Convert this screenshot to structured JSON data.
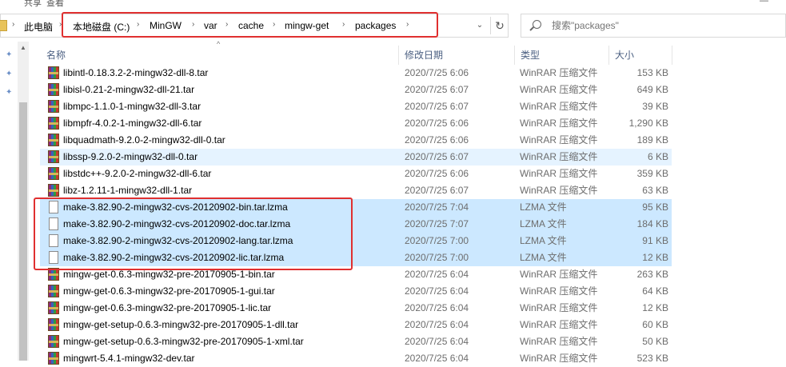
{
  "top_strip": {
    "left1": "共享",
    "left2": "查看",
    "right": "—"
  },
  "breadcrumb": {
    "root": "此电脑",
    "segments": [
      "本地磁盘 (C:)",
      "MinGW",
      "var",
      "cache",
      "mingw-get",
      "packages"
    ]
  },
  "search": {
    "placeholder": "搜索\"packages\""
  },
  "columns": {
    "name": "名称",
    "date": "修改日期",
    "type": "类型",
    "size": "大小"
  },
  "files": [
    {
      "name": "libintl-0.18.3.2-2-mingw32-dll-8.tar",
      "date": "2020/7/25 6:06",
      "type": "WinRAR 压缩文件",
      "size": "153 KB",
      "icon": "rar-archive-icon"
    },
    {
      "name": "libisl-0.21-2-mingw32-dll-21.tar",
      "date": "2020/7/25 6:07",
      "type": "WinRAR 压缩文件",
      "size": "649 KB",
      "icon": "rar-archive-icon"
    },
    {
      "name": "libmpc-1.1.0-1-mingw32-dll-3.tar",
      "date": "2020/7/25 6:07",
      "type": "WinRAR 压缩文件",
      "size": "39 KB",
      "icon": "rar-archive-icon"
    },
    {
      "name": "libmpfr-4.0.2-1-mingw32-dll-6.tar",
      "date": "2020/7/25 6:06",
      "type": "WinRAR 压缩文件",
      "size": "1,290 KB",
      "icon": "rar-archive-icon"
    },
    {
      "name": "libquadmath-9.2.0-2-mingw32-dll-0.tar",
      "date": "2020/7/25 6:06",
      "type": "WinRAR 压缩文件",
      "size": "189 KB",
      "icon": "rar-archive-icon"
    },
    {
      "name": "libssp-9.2.0-2-mingw32-dll-0.tar",
      "date": "2020/7/25 6:07",
      "type": "WinRAR 压缩文件",
      "size": "6 KB",
      "icon": "rar-archive-icon"
    },
    {
      "name": "libstdc++-9.2.0-2-mingw32-dll-6.tar",
      "date": "2020/7/25 6:06",
      "type": "WinRAR 压缩文件",
      "size": "359 KB",
      "icon": "rar-archive-icon"
    },
    {
      "name": "libz-1.2.11-1-mingw32-dll-1.tar",
      "date": "2020/7/25 6:07",
      "type": "WinRAR 压缩文件",
      "size": "63 KB",
      "icon": "rar-archive-icon"
    },
    {
      "name": "make-3.82.90-2-mingw32-cvs-20120902-bin.tar.lzma",
      "date": "2020/7/25 7:04",
      "type": "LZMA 文件",
      "size": "95 KB",
      "icon": "file-icon"
    },
    {
      "name": "make-3.82.90-2-mingw32-cvs-20120902-doc.tar.lzma",
      "date": "2020/7/25 7:07",
      "type": "LZMA 文件",
      "size": "184 KB",
      "icon": "file-icon"
    },
    {
      "name": "make-3.82.90-2-mingw32-cvs-20120902-lang.tar.lzma",
      "date": "2020/7/25 7:00",
      "type": "LZMA 文件",
      "size": "91 KB",
      "icon": "file-icon"
    },
    {
      "name": "make-3.82.90-2-mingw32-cvs-20120902-lic.tar.lzma",
      "date": "2020/7/25 7:00",
      "type": "LZMA 文件",
      "size": "12 KB",
      "icon": "file-icon"
    },
    {
      "name": "mingw-get-0.6.3-mingw32-pre-20170905-1-bin.tar",
      "date": "2020/7/25 6:04",
      "type": "WinRAR 压缩文件",
      "size": "263 KB",
      "icon": "rar-archive-icon"
    },
    {
      "name": "mingw-get-0.6.3-mingw32-pre-20170905-1-gui.tar",
      "date": "2020/7/25 6:04",
      "type": "WinRAR 压缩文件",
      "size": "64 KB",
      "icon": "rar-archive-icon"
    },
    {
      "name": "mingw-get-0.6.3-mingw32-pre-20170905-1-lic.tar",
      "date": "2020/7/25 6:04",
      "type": "WinRAR 压缩文件",
      "size": "12 KB",
      "icon": "rar-archive-icon"
    },
    {
      "name": "mingw-get-setup-0.6.3-mingw32-pre-20170905-1-dll.tar",
      "date": "2020/7/25 6:04",
      "type": "WinRAR 压缩文件",
      "size": "60 KB",
      "icon": "rar-archive-icon"
    },
    {
      "name": "mingw-get-setup-0.6.3-mingw32-pre-20170905-1-xml.tar",
      "date": "2020/7/25 6:04",
      "type": "WinRAR 压缩文件",
      "size": "50 KB",
      "icon": "rar-archive-icon"
    },
    {
      "name": "mingwrt-5.4.1-mingw32-dev.tar",
      "date": "2020/7/25 6:04",
      "type": "WinRAR 压缩文件",
      "size": "523 KB",
      "icon": "rar-archive-icon"
    }
  ],
  "selection": {
    "selected_rows": [
      8,
      9,
      10,
      11
    ],
    "hover_row": 5
  },
  "colors": {
    "selected": "#cce8ff",
    "hover": "#e5f3ff",
    "annotation": "#e03030"
  }
}
